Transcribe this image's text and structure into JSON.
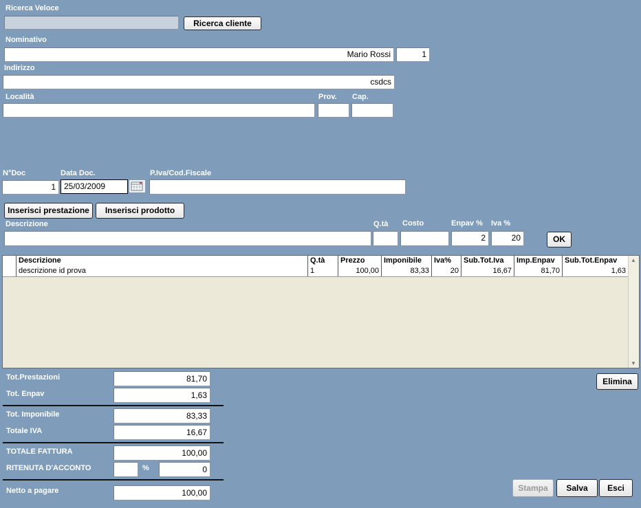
{
  "search": {
    "label": "Ricerca Veloce",
    "value": "",
    "button": "Ricerca cliente"
  },
  "client": {
    "nominativo_label": "Nominativo",
    "nominativo_value": "Mario Rossi",
    "id_value": "1",
    "indirizzo_label": "Indirizzo",
    "indirizzo_value": "csdcs",
    "localita_label": "Località",
    "localita_value": "",
    "prov_label": "Prov.",
    "prov_value": "",
    "cap_label": "Cap.",
    "cap_value": ""
  },
  "document": {
    "ndoc_label": "N°Doc",
    "ndoc_value": "1",
    "data_label": "Data Doc.",
    "data_value": "25/03/2009",
    "piva_label": "P.Iva/Cod.Fiscale",
    "piva_value": ""
  },
  "actions": {
    "inserisci_prestazione": "Inserisci prestazione",
    "inserisci_prodotto": "Inserisci prodotto"
  },
  "entry": {
    "descrizione_label": "Descrizione",
    "descrizione_value": "",
    "qta_label": "Q.tà",
    "qta_value": "",
    "costo_label": "Costo",
    "costo_value": "",
    "enpav_label": "Enpav %",
    "enpav_value": "2",
    "iva_label": "Iva %",
    "iva_value": "20",
    "ok_label": "OK"
  },
  "grid": {
    "columns": [
      "Descrizione",
      "Q.tà",
      "Prezzo",
      "Imponibile",
      "Iva%",
      "Sub.Tot.Iva",
      "Imp.Enpav",
      "Sub.Tot.Enpav"
    ],
    "rows": [
      [
        "descrizione id prova",
        "1",
        "100,00",
        "83,33",
        "20",
        "16,67",
        "81,70",
        "1,63"
      ]
    ]
  },
  "totals": {
    "tot_prestazioni_label": "Tot.Prestazioni",
    "tot_prestazioni_value": "81,70",
    "tot_enpav_label": "Tot. Enpav",
    "tot_enpav_value": "1,63",
    "tot_imponibile_label": "Tot. Imponibile",
    "tot_imponibile_value": "83,33",
    "totale_iva_label": "Totale IVA",
    "totale_iva_value": "16,67",
    "totale_fattura_label": "TOTALE FATTURA",
    "totale_fattura_value": "100,00",
    "ritenuta_label": "RITENUTA D'ACCONTO",
    "ritenuta_pct_value": "",
    "pct_symbol": "%",
    "ritenuta_value": "0",
    "netto_label": "Netto a pagare",
    "netto_value": "100,00"
  },
  "footer": {
    "elimina": "Elimina",
    "stampa": "Stampa",
    "salva": "Salva",
    "esci": "Esci"
  }
}
